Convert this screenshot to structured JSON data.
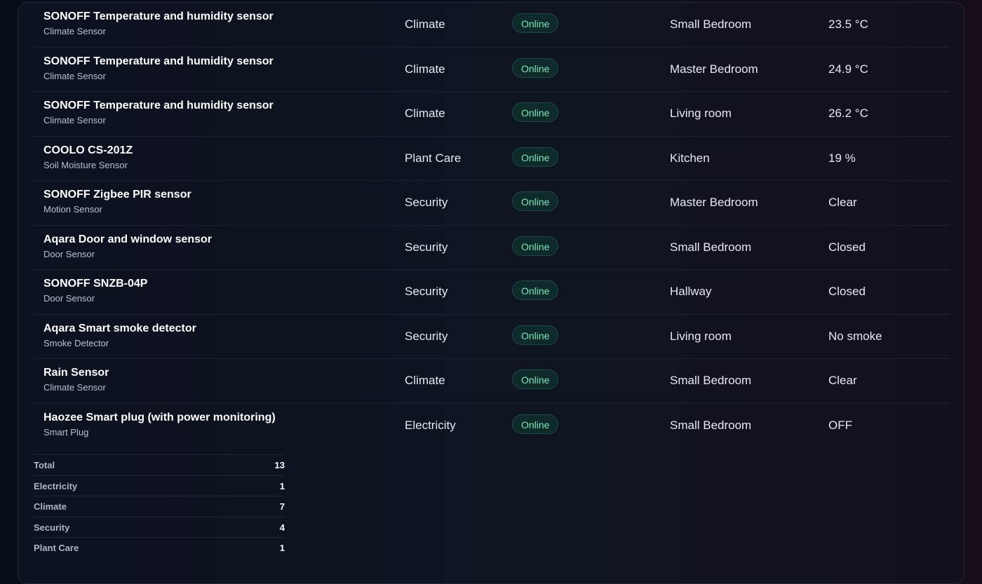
{
  "devices": [
    {
      "name": "SONOFF Temperature and humidity sensor",
      "type": "Climate Sensor",
      "category": "Climate",
      "status": "Online",
      "room": "Small Bedroom",
      "state": "23.5 °C"
    },
    {
      "name": "SONOFF Temperature and humidity sensor",
      "type": "Climate Sensor",
      "category": "Climate",
      "status": "Online",
      "room": "Master Bedroom",
      "state": "24.9 °C"
    },
    {
      "name": "SONOFF Temperature and humidity sensor",
      "type": "Climate Sensor",
      "category": "Climate",
      "status": "Online",
      "room": "Living room",
      "state": "26.2 °C"
    },
    {
      "name": "COOLO CS-201Z",
      "type": "Soil Moisture Sensor",
      "category": "Plant Care",
      "status": "Online",
      "room": "Kitchen",
      "state": "19 %"
    },
    {
      "name": "SONOFF Zigbee PIR sensor",
      "type": "Motion Sensor",
      "category": "Security",
      "status": "Online",
      "room": "Master Bedroom",
      "state": "Clear"
    },
    {
      "name": "Aqara Door and window sensor",
      "type": "Door Sensor",
      "category": "Security",
      "status": "Online",
      "room": "Small Bedroom",
      "state": "Closed"
    },
    {
      "name": "SONOFF SNZB-04P",
      "type": "Door Sensor",
      "category": "Security",
      "status": "Online",
      "room": "Hallway",
      "state": "Closed"
    },
    {
      "name": "Aqara Smart smoke detector",
      "type": "Smoke Detector",
      "category": "Security",
      "status": "Online",
      "room": "Living room",
      "state": "No smoke"
    },
    {
      "name": "Rain Sensor",
      "type": "Climate Sensor",
      "category": "Climate",
      "status": "Online",
      "room": "Small Bedroom",
      "state": "Clear"
    },
    {
      "name": "Haozee Smart plug (with power monitoring)",
      "type": "Smart Plug",
      "category": "Electricity",
      "status": "Online",
      "room": "Small Bedroom",
      "state": "OFF"
    }
  ],
  "summary": [
    {
      "label": "Total",
      "value": "13"
    },
    {
      "label": "Electricity",
      "value": "1"
    },
    {
      "label": "Climate",
      "value": "7"
    },
    {
      "label": "Security",
      "value": "4"
    },
    {
      "label": "Plant Care",
      "value": "1"
    }
  ],
  "colors": {
    "background": "#0c111f",
    "online_badge_bg": "#0e2a2a",
    "online_badge_text": "#7fe6b4"
  }
}
